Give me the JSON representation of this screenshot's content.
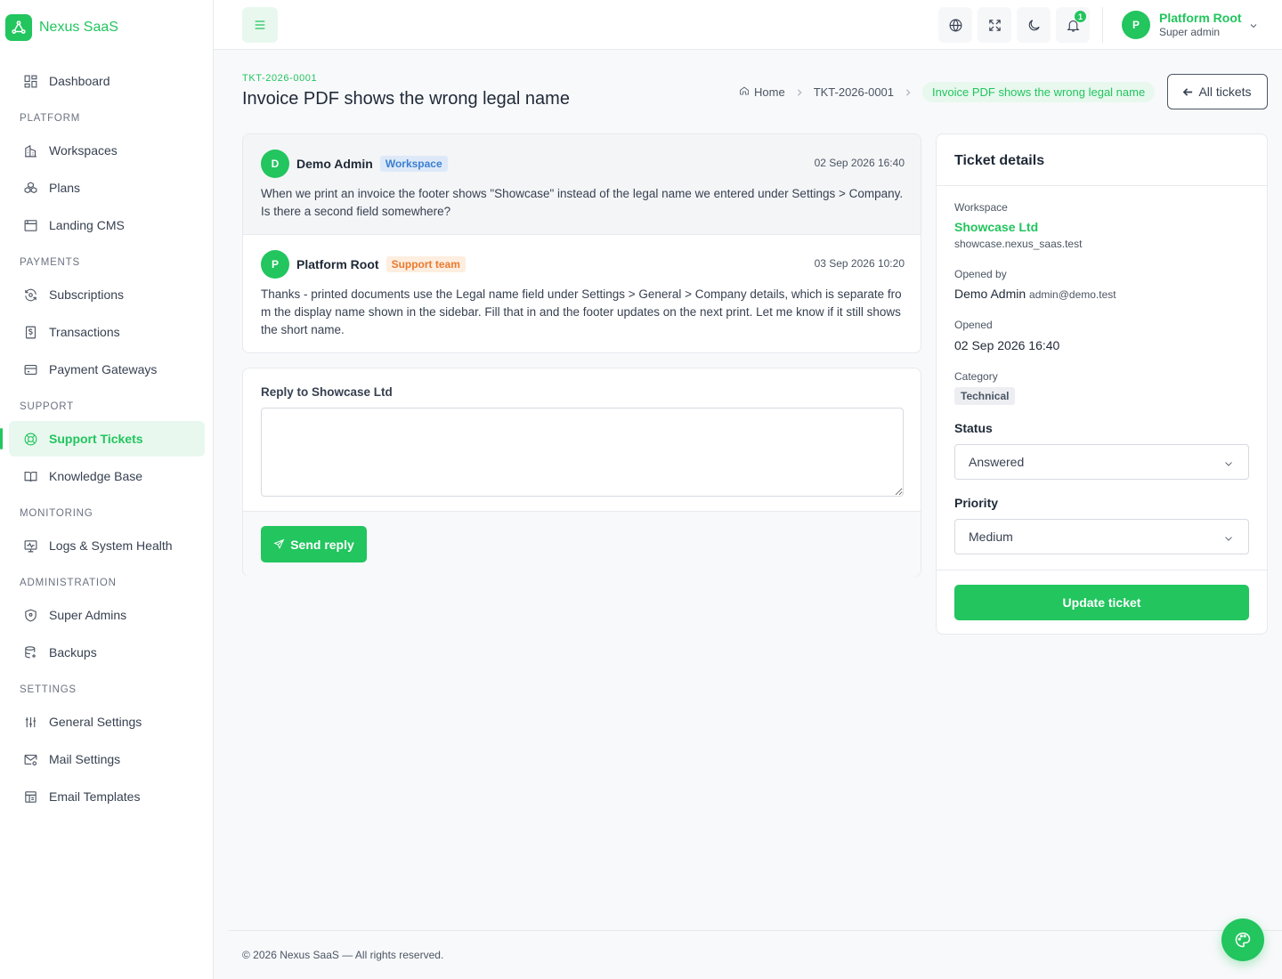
{
  "brand": {
    "name": "Nexus SaaS"
  },
  "sidebar": {
    "dashboard": "Dashboard",
    "sections": {
      "platform": "PLATFORM",
      "payments": "PAYMENTS",
      "support": "SUPPORT",
      "monitoring": "MONITORING",
      "administration": "ADMINISTRATION",
      "settings": "SETTINGS"
    },
    "items": {
      "workspaces": "Workspaces",
      "plans": "Plans",
      "landing_cms": "Landing CMS",
      "subscriptions": "Subscriptions",
      "transactions": "Transactions",
      "payment_gateways": "Payment Gateways",
      "support_tickets": "Support Tickets",
      "knowledge_base": "Knowledge Base",
      "logs": "Logs & System Health",
      "super_admins": "Super Admins",
      "backups": "Backups",
      "general_settings": "General Settings",
      "mail_settings": "Mail Settings",
      "email_templates": "Email Templates"
    },
    "active_item": "support_tickets"
  },
  "topbar": {
    "notification_count": "1",
    "user": {
      "initial": "P",
      "name": "Platform Root",
      "role": "Super admin"
    },
    "icons": [
      "menu-icon",
      "globe-icon",
      "fullscreen-icon",
      "moon-icon",
      "bell-icon",
      "chevron-down-icon"
    ]
  },
  "page": {
    "ticket_code": "TKT-2026-0001",
    "title": "Invoice PDF shows the wrong legal name",
    "breadcrumb": {
      "home": "Home",
      "ticket": "TKT-2026-0001",
      "current": "Invoice PDF shows the wrong legal name"
    },
    "all_tickets_label": "All tickets"
  },
  "messages": [
    {
      "initial": "D",
      "author": "Demo Admin",
      "tag": "Workspace",
      "time": "02 Sep 2026 16:40",
      "body": "When we print an invoice the footer shows \"Showcase\" instead of the legal name we entered under Settings > Company. Is there a second field somewhere?"
    },
    {
      "initial": "P",
      "author": "Platform Root",
      "tag": "Support team",
      "time": "03 Sep 2026 10:20",
      "body": "Thanks - printed documents use the Legal name field under Settings > General > Company details, which is separate from the display name shown in the sidebar. Fill that in and the footer updates on the next print. Let me know if it still shows the short name."
    }
  ],
  "reply": {
    "label": "Reply to Showcase Ltd",
    "value": "",
    "send_label": "Send reply"
  },
  "details": {
    "title": "Ticket details",
    "workspace_label": "Workspace",
    "workspace_name": "Showcase Ltd",
    "workspace_domain": "showcase.nexus_saas.test",
    "opened_by_label": "Opened by",
    "opened_by_name": "Demo Admin",
    "opened_by_email": "admin@demo.test",
    "opened_label": "Opened",
    "opened_value": "02 Sep 2026 16:40",
    "category_label": "Category",
    "category_value": "Technical",
    "status_label": "Status",
    "status_value": "Answered",
    "priority_label": "Priority",
    "priority_value": "Medium",
    "update_label": "Update ticket"
  },
  "footer": {
    "text": "© 2026 Nexus SaaS — All rights reserved."
  },
  "colors": {
    "accent": "#22c55e",
    "accent_soft": "#e8f8ee",
    "tag_blue": "#3b7fd0",
    "tag_orange": "#ea7a30"
  }
}
